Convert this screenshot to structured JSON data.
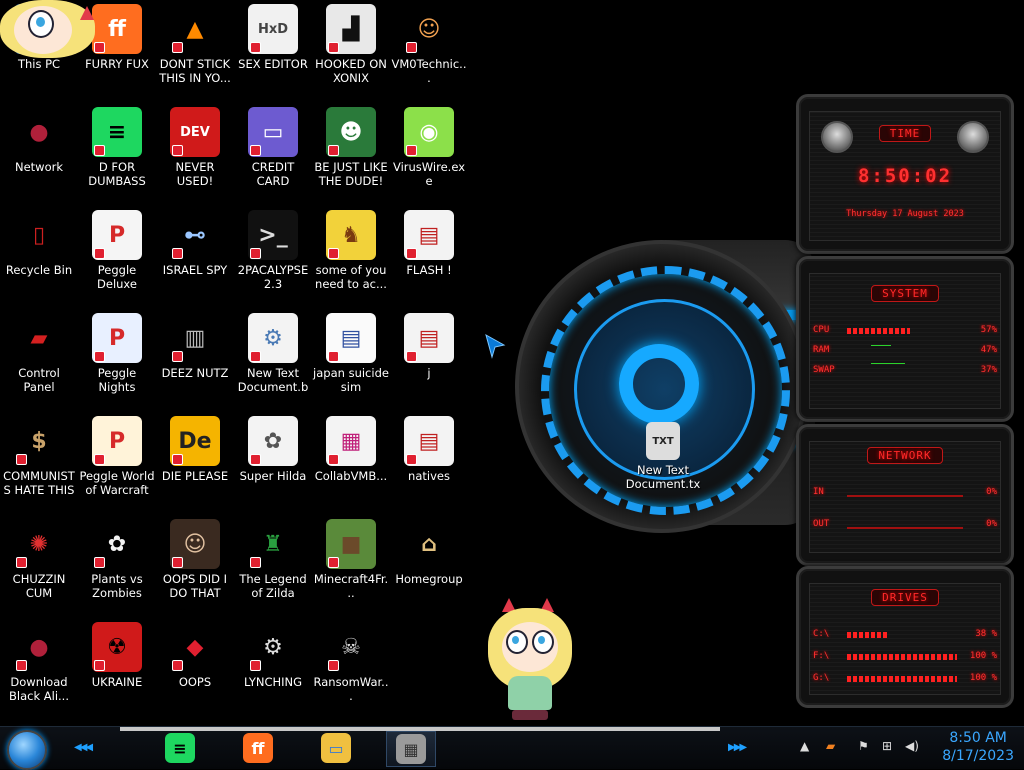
{
  "desktop": {
    "icons": [
      {
        "label": "This PC",
        "glyph": "PC",
        "bg": "#2f77c8",
        "fg": "#fff"
      },
      {
        "label": "FURRY FUX",
        "glyph": "ff",
        "bg": "#ff6d1f",
        "fg": "#fff"
      },
      {
        "label": "DONT STICK THIS IN YO...",
        "glyph": "▲",
        "bg": "#000",
        "fg": "#ff8a00"
      },
      {
        "label": "SEX EDITOR",
        "glyph": "HxD",
        "bg": "#f1f1f1",
        "fg": "#444"
      },
      {
        "label": "HOOKED ON XONIX",
        "glyph": "▟",
        "bg": "#e8e8e8",
        "fg": "#111"
      },
      {
        "label": "VM0Technic...",
        "glyph": "☺",
        "bg": "#000",
        "fg": "#f0a050"
      },
      {
        "label": "Network",
        "glyph": "●",
        "bg": "#000",
        "fg": "#b0203a"
      },
      {
        "label": "D FOR DUMBASS",
        "glyph": "≡",
        "bg": "#1ed760",
        "fg": "#000"
      },
      {
        "label": "NEVER USED!",
        "glyph": "DEV",
        "bg": "#d01a1a",
        "fg": "#fff"
      },
      {
        "label": "CREDIT CARD CHECKER",
        "glyph": "▭",
        "bg": "#6d5bd0",
        "fg": "#fff"
      },
      {
        "label": "BE JUST LIKE THE DUDE!",
        "glyph": "☻",
        "bg": "#2a7a3a",
        "fg": "#fff"
      },
      {
        "label": "VirusWire.exe",
        "glyph": "◉",
        "bg": "#8ce04a",
        "fg": "#fff"
      },
      {
        "label": "Recycle Bin",
        "glyph": "▯",
        "bg": "#000",
        "fg": "#cc2020"
      },
      {
        "label": "Peggle Deluxe",
        "glyph": "P",
        "bg": "#f5f5f5",
        "fg": "#d62a2a"
      },
      {
        "label": "ISRAEL SPY",
        "glyph": "⊷",
        "bg": "#000",
        "fg": "#9bc7ff"
      },
      {
        "label": "2PACALYPSE 2.3",
        "glyph": ">_",
        "bg": "#111",
        "fg": "#ddd"
      },
      {
        "label": "some of you need to ac...",
        "glyph": "♞",
        "bg": "#f2d23a",
        "fg": "#7a3b10"
      },
      {
        "label": "FLASH !",
        "glyph": "▤",
        "bg": "#f3f3f3",
        "fg": "#c02020"
      },
      {
        "label": "Control Panel",
        "glyph": "▰",
        "bg": "#000",
        "fg": "#d42020"
      },
      {
        "label": "Peggle Nights Deluxe",
        "glyph": "P",
        "bg": "#e8f0ff",
        "fg": "#d62a2a"
      },
      {
        "label": "DEEZ NUTZ",
        "glyph": "▥",
        "bg": "#000",
        "fg": "#bbb"
      },
      {
        "label": "New Text Document.bat",
        "glyph": "⚙",
        "bg": "#f3f3f3",
        "fg": "#4a7ab5"
      },
      {
        "label": "japan suicide sim",
        "glyph": "▤",
        "bg": "#fafafa",
        "fg": "#3050a0"
      },
      {
        "label": "j",
        "glyph": "▤",
        "bg": "#f3f3f3",
        "fg": "#c02020"
      },
      {
        "label": "COMMUNISTS HATE THIS G...",
        "glyph": "$",
        "bg": "#000",
        "fg": "#c9a26a"
      },
      {
        "label": "Peggle World of Warcraft ...",
        "glyph": "P",
        "bg": "#fff3d9",
        "fg": "#d62a2a"
      },
      {
        "label": "DIE PLEASE",
        "glyph": "De",
        "bg": "#f5b400",
        "fg": "#222"
      },
      {
        "label": "Super Hilda",
        "glyph": "✿",
        "bg": "#f3f3f3",
        "fg": "#555"
      },
      {
        "label": "CollabVMB...",
        "glyph": "▦",
        "bg": "#f3f3f3",
        "fg": "#c0207a"
      },
      {
        "label": "natives",
        "glyph": "▤",
        "bg": "#f3f3f3",
        "fg": "#c02020"
      },
      {
        "label": "CHUZZIN CUM",
        "glyph": "✺",
        "bg": "#000",
        "fg": "#e23030"
      },
      {
        "label": "Plants vs Zombies",
        "glyph": "✿",
        "bg": "#000",
        "fg": "#f2f2f2"
      },
      {
        "label": "OOPS DID I DO THAT",
        "glyph": "☺",
        "bg": "#3a2a20",
        "fg": "#e0c0a0"
      },
      {
        "label": "The Legend of Zilda",
        "glyph": "♜",
        "bg": "#000",
        "fg": "#2aa040"
      },
      {
        "label": "Minecraft4Fr...",
        "glyph": "■",
        "bg": "#5a8a3a",
        "fg": "#6b4a2a"
      },
      {
        "label": "Homegroup",
        "glyph": "⌂",
        "bg": "#000",
        "fg": "#e0c080"
      },
      {
        "label": "Download Black Ali...",
        "glyph": "●",
        "bg": "#000",
        "fg": "#b0203a"
      },
      {
        "label": "UKRAINE",
        "glyph": "☢",
        "bg": "#d01a1a",
        "fg": "#000"
      },
      {
        "label": "OOPS",
        "glyph": "◆",
        "bg": "#000",
        "fg": "#e02030"
      },
      {
        "label": "LYNCHING",
        "glyph": "⚙",
        "bg": "#000",
        "fg": "#ddd"
      },
      {
        "label": "RansomWar...",
        "glyph": "☠",
        "bg": "#000",
        "fg": "#ddd"
      }
    ],
    "extra_icon": {
      "label": "New Text Document.txt",
      "glyph": "TXT"
    }
  },
  "widgets": {
    "time": {
      "title": "TIME",
      "clock": "8:50:02",
      "date": "Thursday 17 August 2023"
    },
    "system": {
      "title": "SYSTEM",
      "rows": [
        {
          "label": "CPU",
          "value": "57%",
          "fill": 0.57
        },
        {
          "label": "RAM",
          "value": "47%",
          "fill": 0.47
        },
        {
          "label": "SWAP",
          "value": "37%",
          "fill": 0.37
        }
      ]
    },
    "network": {
      "title": "NETWORK",
      "rows": [
        {
          "label": "IN",
          "value": "0%"
        },
        {
          "label": "OUT",
          "value": "0%"
        }
      ]
    },
    "drives": {
      "title": "DRIVES",
      "rows": [
        {
          "label": "C:\\",
          "value": "38 %",
          "fill": 0.38
        },
        {
          "label": "F:\\",
          "value": "100 %",
          "fill": 1.0
        },
        {
          "label": "G:\\",
          "value": "100 %",
          "fill": 1.0
        }
      ]
    }
  },
  "taskbar": {
    "apps": [
      {
        "name": "spotify",
        "glyph": "≡",
        "bg": "#1ed760",
        "fg": "#000"
      },
      {
        "name": "firefox",
        "glyph": "ff",
        "bg": "#ff6d1f",
        "fg": "#fff"
      },
      {
        "name": "file-explorer",
        "glyph": "▭",
        "bg": "#f0c040",
        "fg": "#3a7ad0"
      },
      {
        "name": "wall-app",
        "glyph": "▦",
        "bg": "#9a9a9a",
        "fg": "#333"
      }
    ],
    "clock_time": "8:50 AM",
    "clock_date": "8/17/2023"
  },
  "colors": {
    "accent": "#1ea0ff",
    "widget_red": "#ff3030"
  }
}
